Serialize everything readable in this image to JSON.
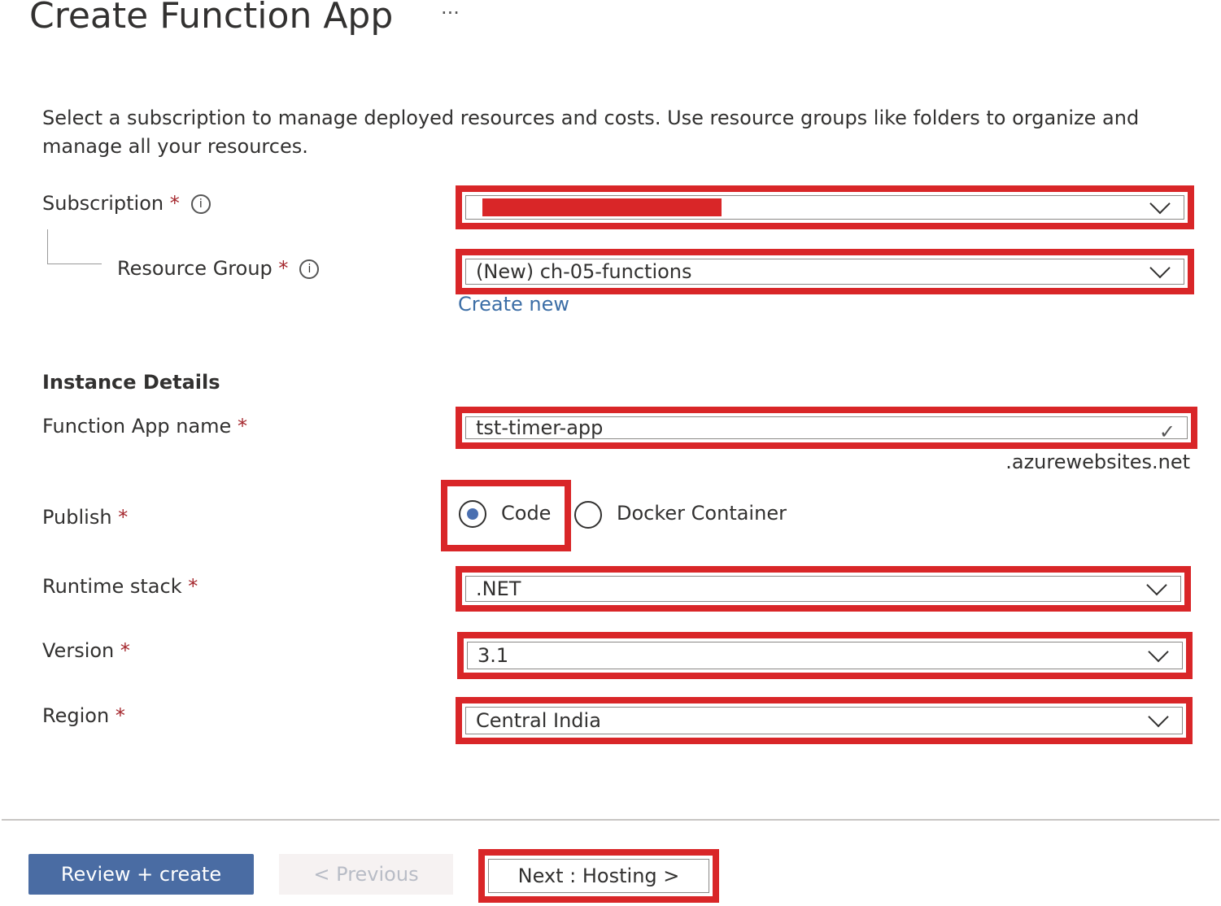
{
  "header": {
    "title": "Create Function App",
    "more_label": "···"
  },
  "description": "Select a subscription to manage deployed resources and costs. Use resource groups like folders to organize and manage all your resources.",
  "project": {
    "subscription": {
      "label": "Subscription",
      "required": "*",
      "info_icon": "info-icon"
    },
    "resource_group": {
      "label": "Resource Group",
      "required": "*",
      "value": "(New) ch-05-functions",
      "create_new": "Create new"
    }
  },
  "instance": {
    "heading": "Instance Details",
    "name": {
      "label": "Function App name",
      "required": "*",
      "value": "tst-timer-app",
      "suffix": ".azurewebsites.net"
    },
    "publish": {
      "label": "Publish",
      "required": "*",
      "options": [
        "Code",
        "Docker Container"
      ],
      "selected": "Code"
    },
    "runtime": {
      "label": "Runtime stack",
      "required": "*",
      "value": ".NET"
    },
    "version": {
      "label": "Version",
      "required": "*",
      "value": "3.1"
    },
    "region": {
      "label": "Region",
      "required": "*",
      "value": "Central India"
    }
  },
  "footer": {
    "review": "Review + create",
    "previous": "< Previous",
    "next": "Next : Hosting >"
  },
  "colors": {
    "highlight": "#d92628",
    "primary": "#4a6ca3",
    "link": "#3c6ea6"
  }
}
